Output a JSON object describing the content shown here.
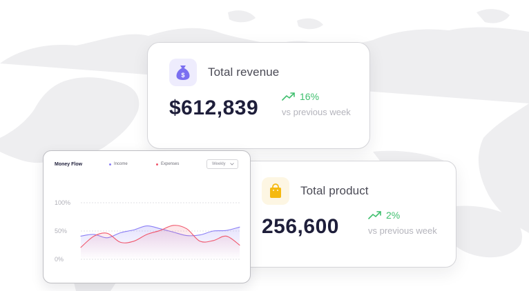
{
  "revenue_card": {
    "label": "Total revenue",
    "value": "$612,839",
    "trend_pct": "16%",
    "trend_caption": "vs previous week",
    "icon": "money-bag-icon"
  },
  "product_card": {
    "label": "Total product",
    "value": "256,600",
    "trend_pct": "2%",
    "trend_caption": "vs previous week",
    "icon": "shopping-bag-icon"
  },
  "money_flow": {
    "title": "Money Flow",
    "legend": {
      "income": "Income",
      "expenses": "Expenses"
    },
    "period": {
      "selected": "Weekly"
    }
  },
  "colors": {
    "accent_purple": "#7b6ff0",
    "income_line": "#8a7ef5",
    "expenses_line": "#f0566b",
    "trend_green": "#3fbf6e",
    "product_icon_yellow": "#f5b90f",
    "value_text": "#1e1e3a"
  },
  "chart_data": {
    "type": "line",
    "title": "Money Flow",
    "y_ticks": [
      "100%",
      "50%",
      "0%"
    ],
    "ylim": [
      0,
      100
    ],
    "x": [
      0,
      1,
      2,
      3,
      4,
      5,
      6,
      7,
      8,
      9,
      10,
      11,
      12
    ],
    "grid": true,
    "legend": "top",
    "series": [
      {
        "name": "Income",
        "color": "#8a7ef5",
        "values": [
          41,
          44,
          38,
          47,
          52,
          59,
          54,
          48,
          42,
          43,
          50,
          51,
          57
        ]
      },
      {
        "name": "Expenses",
        "color": "#f0566b",
        "values": [
          21,
          41,
          46,
          30,
          32,
          44,
          51,
          60,
          54,
          32,
          33,
          41,
          25
        ]
      }
    ]
  }
}
